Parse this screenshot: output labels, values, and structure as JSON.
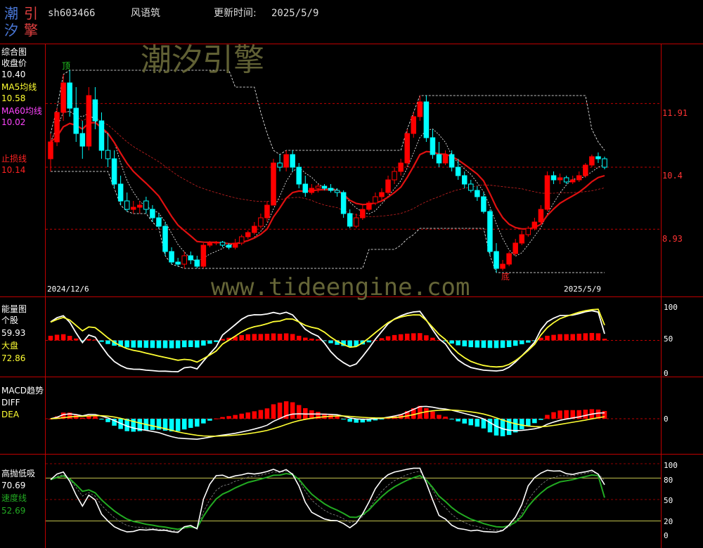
{
  "header": {
    "logo_chars": [
      "潮",
      "引",
      "汐",
      "擎"
    ],
    "code": "sh603466",
    "name": "风语筑",
    "update_label": "更新时间:",
    "update_date": "2025/5/9"
  },
  "watermark": {
    "brand": "潮汐引擎",
    "url": "www.tideengine.com"
  },
  "colors": {
    "up": "#ff0000",
    "down": "#00ffff",
    "ma5": "#ffffff",
    "ma60": "#cc0000",
    "grid": "#c00000",
    "axis_text": "#ff3333",
    "yellow": "#ffff33",
    "green": "#22aa22"
  },
  "panels": {
    "main": {
      "label": "综合图",
      "close_label": "收盘价",
      "close_value": "10.40",
      "ma5_label": "MA5均线",
      "ma5_value": "10.58",
      "ma60_label": "MA60均线",
      "ma60_value": "10.02",
      "stop_label": "止损线",
      "stop_value": "10.14",
      "top_mark": "顶",
      "bottom_mark": "底",
      "start_date": "2024/12/6",
      "end_date": "2025/5/9",
      "y_ticks": [
        "11.91",
        "10.4",
        "8.93"
      ]
    },
    "energy": {
      "label": "能量图",
      "stock_label": "个股",
      "stock_value": "59.93",
      "market_label": "大盘",
      "market_value": "72.86",
      "y_ticks": [
        "100",
        "50",
        "0"
      ]
    },
    "macd": {
      "label": "MACD趋势",
      "diff_label": "DIFF",
      "dea_label": "DEA",
      "y_ticks": [
        "0"
      ]
    },
    "gaopao": {
      "label": "高抛低吸",
      "value": "70.69",
      "speed_label": "速度线",
      "speed_value": "52.69",
      "y_ticks": [
        "100",
        "80",
        "50",
        "20",
        "0"
      ]
    }
  },
  "chart_data": {
    "type": "candlestick",
    "dates_shown": [
      "2024/12/6",
      "2025/5/9"
    ],
    "price_levels": [
      11.91,
      10.4,
      8.93
    ],
    "ohlc": [
      [
        10.6,
        11.2,
        10.3,
        11.0
      ],
      [
        11.0,
        11.8,
        10.9,
        11.7
      ],
      [
        11.7,
        12.6,
        11.5,
        12.4
      ],
      [
        12.4,
        12.7,
        11.6,
        11.8
      ],
      [
        11.8,
        12.3,
        11.0,
        11.2
      ],
      [
        11.2,
        11.5,
        10.6,
        10.9
      ],
      [
        10.9,
        12.3,
        10.8,
        12.1
      ],
      [
        12.0,
        12.3,
        11.3,
        11.5
      ],
      [
        11.5,
        11.7,
        10.6,
        10.8
      ],
      [
        10.8,
        11.2,
        10.4,
        10.6
      ],
      [
        10.6,
        10.8,
        9.9,
        10.0
      ],
      [
        10.0,
        10.2,
        9.5,
        9.6
      ],
      [
        9.6,
        9.8,
        9.35,
        9.4
      ],
      [
        9.4,
        9.6,
        9.3,
        9.45
      ],
      [
        9.45,
        9.6,
        9.3,
        9.5
      ],
      [
        9.6,
        9.7,
        9.3,
        9.4
      ],
      [
        9.4,
        9.5,
        9.1,
        9.2
      ],
      [
        9.2,
        9.3,
        8.95,
        9.0
      ],
      [
        9.0,
        9.1,
        8.3,
        8.4
      ],
      [
        8.4,
        8.5,
        8.1,
        8.15
      ],
      [
        8.15,
        8.25,
        8.05,
        8.1
      ],
      [
        8.1,
        8.4,
        8.0,
        8.3
      ],
      [
        8.3,
        8.4,
        8.1,
        8.2
      ],
      [
        8.2,
        8.3,
        8.0,
        8.05
      ],
      [
        8.05,
        8.6,
        8.0,
        8.55
      ],
      [
        8.55,
        8.65,
        8.5,
        8.6
      ],
      [
        8.6,
        8.65,
        8.55,
        8.62
      ],
      [
        8.62,
        8.65,
        8.5,
        8.55
      ],
      [
        8.55,
        8.6,
        8.45,
        8.5
      ],
      [
        8.5,
        8.7,
        8.45,
        8.6
      ],
      [
        8.6,
        8.8,
        8.55,
        8.75
      ],
      [
        8.75,
        8.9,
        8.7,
        8.85
      ],
      [
        8.85,
        9.1,
        8.8,
        9.0
      ],
      [
        9.0,
        9.3,
        8.95,
        9.2
      ],
      [
        9.2,
        9.6,
        9.1,
        9.5
      ],
      [
        9.5,
        10.6,
        9.5,
        10.5
      ],
      [
        10.5,
        10.7,
        10.3,
        10.4
      ],
      [
        10.4,
        10.8,
        10.3,
        10.7
      ],
      [
        10.7,
        10.8,
        10.3,
        10.4
      ],
      [
        10.4,
        10.5,
        9.9,
        10.0
      ],
      [
        10.0,
        10.2,
        9.7,
        9.8
      ],
      [
        9.8,
        10.0,
        9.75,
        9.9
      ],
      [
        9.9,
        10.0,
        9.8,
        9.95
      ],
      [
        9.95,
        10.0,
        9.85,
        9.9
      ],
      [
        9.9,
        10.0,
        9.8,
        9.85
      ],
      [
        9.85,
        9.9,
        9.7,
        9.8
      ],
      [
        9.8,
        9.85,
        9.2,
        9.3
      ],
      [
        9.3,
        9.4,
        8.95,
        9.0
      ],
      [
        9.0,
        9.3,
        8.95,
        9.2
      ],
      [
        9.2,
        9.5,
        9.15,
        9.4
      ],
      [
        9.4,
        9.6,
        9.35,
        9.55
      ],
      [
        9.55,
        9.8,
        9.5,
        9.7
      ],
      [
        9.7,
        9.9,
        9.6,
        9.8
      ],
      [
        9.8,
        10.2,
        9.75,
        10.1
      ],
      [
        10.1,
        10.4,
        10.0,
        10.3
      ],
      [
        10.3,
        10.6,
        10.2,
        10.5
      ],
      [
        10.5,
        11.3,
        10.4,
        11.2
      ],
      [
        11.2,
        11.7,
        11.1,
        11.6
      ],
      [
        11.6,
        12.1,
        11.5,
        11.95
      ],
      [
        11.95,
        12.1,
        11.0,
        11.1
      ],
      [
        11.1,
        11.3,
        10.6,
        10.7
      ],
      [
        10.7,
        11.0,
        10.4,
        10.5
      ],
      [
        10.5,
        10.8,
        10.45,
        10.7
      ],
      [
        10.7,
        10.8,
        10.3,
        10.4
      ],
      [
        10.4,
        10.6,
        10.1,
        10.2
      ],
      [
        10.2,
        10.3,
        9.9,
        10.0
      ],
      [
        10.0,
        10.1,
        9.8,
        9.85
      ],
      [
        9.85,
        9.95,
        9.6,
        9.7
      ],
      [
        9.7,
        9.8,
        9.3,
        9.35
      ],
      [
        9.35,
        9.4,
        8.3,
        8.4
      ],
      [
        8.4,
        8.6,
        7.9,
        8.0
      ],
      [
        8.0,
        8.2,
        7.95,
        8.1
      ],
      [
        8.1,
        8.4,
        8.05,
        8.35
      ],
      [
        8.35,
        8.7,
        8.3,
        8.6
      ],
      [
        8.6,
        8.9,
        8.55,
        8.8
      ],
      [
        8.8,
        9.0,
        8.75,
        8.95
      ],
      [
        8.95,
        9.2,
        8.9,
        9.1
      ],
      [
        9.1,
        9.5,
        9.05,
        9.4
      ],
      [
        9.4,
        10.3,
        9.35,
        10.2
      ],
      [
        10.2,
        10.3,
        10.0,
        10.1
      ],
      [
        10.1,
        10.25,
        10.0,
        10.15
      ],
      [
        10.15,
        10.2,
        10.0,
        10.05
      ],
      [
        10.05,
        10.2,
        10.0,
        10.1
      ],
      [
        10.1,
        10.3,
        10.05,
        10.2
      ],
      [
        10.2,
        10.5,
        10.15,
        10.45
      ],
      [
        10.45,
        10.7,
        10.4,
        10.65
      ],
      [
        10.65,
        10.75,
        10.5,
        10.6
      ],
      [
        10.6,
        10.65,
        10.35,
        10.4
      ]
    ],
    "energy_stock_last": 59.93,
    "energy_market_last": 72.86,
    "gaopao_last": 70.69,
    "speed_last": 52.69
  }
}
